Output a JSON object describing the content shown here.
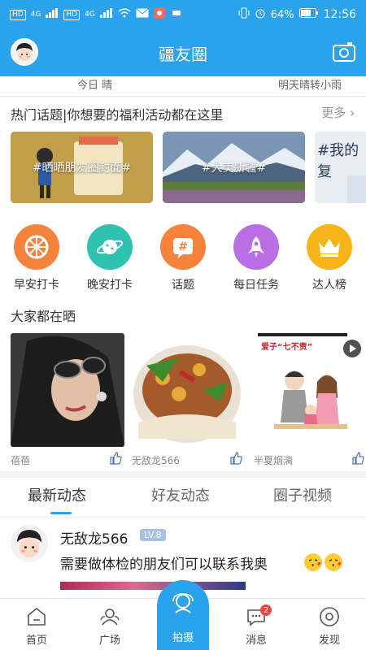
{
  "status_bar": {
    "hd1": "HD",
    "hd2": "HD",
    "sig1": "4G",
    "sig2": "4G",
    "battery": "64%",
    "time": "12:56"
  },
  "header": {
    "title": "疆友圈"
  },
  "weather": {
    "today": "今日 晴",
    "tomorrow": "明天晴转小雨"
  },
  "hot_topics": {
    "title": "热门话题|你想要的福利活动都在这里",
    "more": "更多",
    "items": [
      {
        "label": "#晒晒朋友圈封面#"
      },
      {
        "label": "#大美新疆#"
      },
      {
        "label": "#我的复"
      }
    ]
  },
  "quick_actions": [
    {
      "label": "早安打卡",
      "color": "#f5833b",
      "icon": "wheel-icon"
    },
    {
      "label": "晚安打卡",
      "color": "#2fc2b0",
      "icon": "planet-icon"
    },
    {
      "label": "话题",
      "color": "#f5833b",
      "icon": "hashtag-icon"
    },
    {
      "label": "每日任务",
      "color": "#b96ee3",
      "icon": "rocket-icon"
    },
    {
      "label": "达人榜",
      "color": "#f6b417",
      "icon": "crown-icon"
    }
  ],
  "shares": {
    "title": "大家都在晒",
    "items": [
      {
        "name": "蓓蓓"
      },
      {
        "name": "无敌龙566"
      },
      {
        "name": "半夏烟漓",
        "caption": "爱子“七不责”"
      }
    ]
  },
  "feed_tabs": [
    {
      "label": "最新动态",
      "active": true
    },
    {
      "label": "好友动态",
      "active": false
    },
    {
      "label": "圈子视频",
      "active": false
    }
  ],
  "post": {
    "user": "无敌龙566",
    "level": "LV.8",
    "text": "需要做体检的朋友们可以联系我奥"
  },
  "bottom_nav": {
    "home": "首页",
    "square": "广场",
    "shoot": "拍摄",
    "messages": "消息",
    "discover": "发现",
    "badge": "2"
  },
  "colors": {
    "primary": "#2aa3ec",
    "badge": "#f14444"
  }
}
